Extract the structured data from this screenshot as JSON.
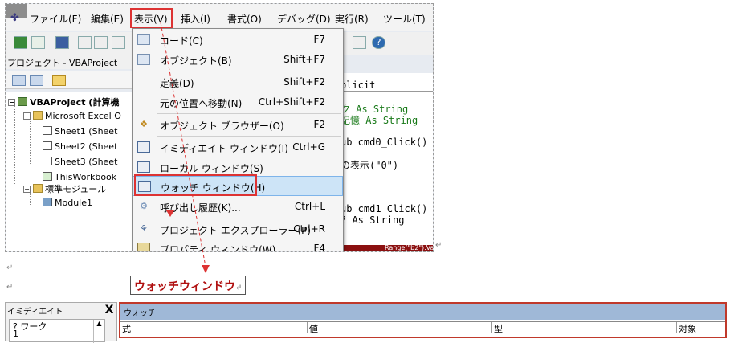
{
  "menubar": {
    "items": [
      {
        "label": "ファイル(F)"
      },
      {
        "label": "編集(E)"
      },
      {
        "label": "表示(V)"
      },
      {
        "label": "挿入(I)"
      },
      {
        "label": "書式(O)"
      },
      {
        "label": "デバッグ(D)"
      },
      {
        "label": "実行(R)"
      },
      {
        "label": "ツール(T)"
      }
    ]
  },
  "project": {
    "header": "プロジェクト - VBAProject",
    "tree": [
      {
        "label": "VBAProject (計算機"
      },
      {
        "label": "Microsoft Excel O"
      },
      {
        "label": "Sheet1 (Sheet"
      },
      {
        "label": "Sheet2 (Sheet"
      },
      {
        "label": "Sheet3 (Sheet"
      },
      {
        "label": "ThisWorkbook"
      },
      {
        "label": "標準モジュール"
      },
      {
        "label": "Module1"
      }
    ]
  },
  "code": {
    "lines": [
      "plicit",
      "ク As String",
      "記憶 As String",
      "ub cmd0_Click()",
      "の表示(\"0\")",
      "ub cmd1_Click()",
      "? As String"
    ],
    "footer": "Range(\"b2\").Valu"
  },
  "view_menu": {
    "items": [
      {
        "icon": "code-icon",
        "label": "コード(C)",
        "shortcut": "F7"
      },
      {
        "icon": "object-icon",
        "label": "オブジェクト(B)",
        "shortcut": "Shift+F7"
      },
      {
        "icon": "",
        "label": "定義(D)",
        "shortcut": "Shift+F2"
      },
      {
        "icon": "",
        "label": "元の位置へ移動(N)",
        "shortcut": "Ctrl+Shift+F2"
      },
      {
        "icon": "object-browser-icon",
        "label": "オブジェクト ブラウザー(O)",
        "shortcut": "F2"
      },
      {
        "icon": "immediate-window-icon",
        "label": "イミディエイト ウィンドウ(I)",
        "shortcut": "Ctrl+G"
      },
      {
        "icon": "locals-window-icon",
        "label": "ローカル ウィンドウ(S)",
        "shortcut": ""
      },
      {
        "icon": "watch-window-icon",
        "label": "ウォッチ ウィンドウ(H)",
        "shortcut": ""
      },
      {
        "icon": "call-stack-icon",
        "label": "呼び出し履歴(K)...",
        "shortcut": "Ctrl+L"
      },
      {
        "icon": "project-explorer-icon",
        "label": "プロジェクト エクスプローラー(P)",
        "shortcut": "Ctrl+R"
      },
      {
        "icon": "properties-window-icon",
        "label": "プロパティ ウィンドウ(W)",
        "shortcut": "F4"
      }
    ]
  },
  "caption": {
    "text": "ウォッチウィンドウ"
  },
  "immediate": {
    "title": "イミディエイト",
    "close": "X",
    "lines": [
      "? ワーク",
      "1"
    ]
  },
  "watch": {
    "title": "ウォッチ",
    "columns": [
      "式",
      "値",
      "型",
      "対象"
    ]
  },
  "colors": {
    "highlight": "#dd3333",
    "selected": "#cde4f7",
    "watch_title": "#9fb8d7"
  }
}
